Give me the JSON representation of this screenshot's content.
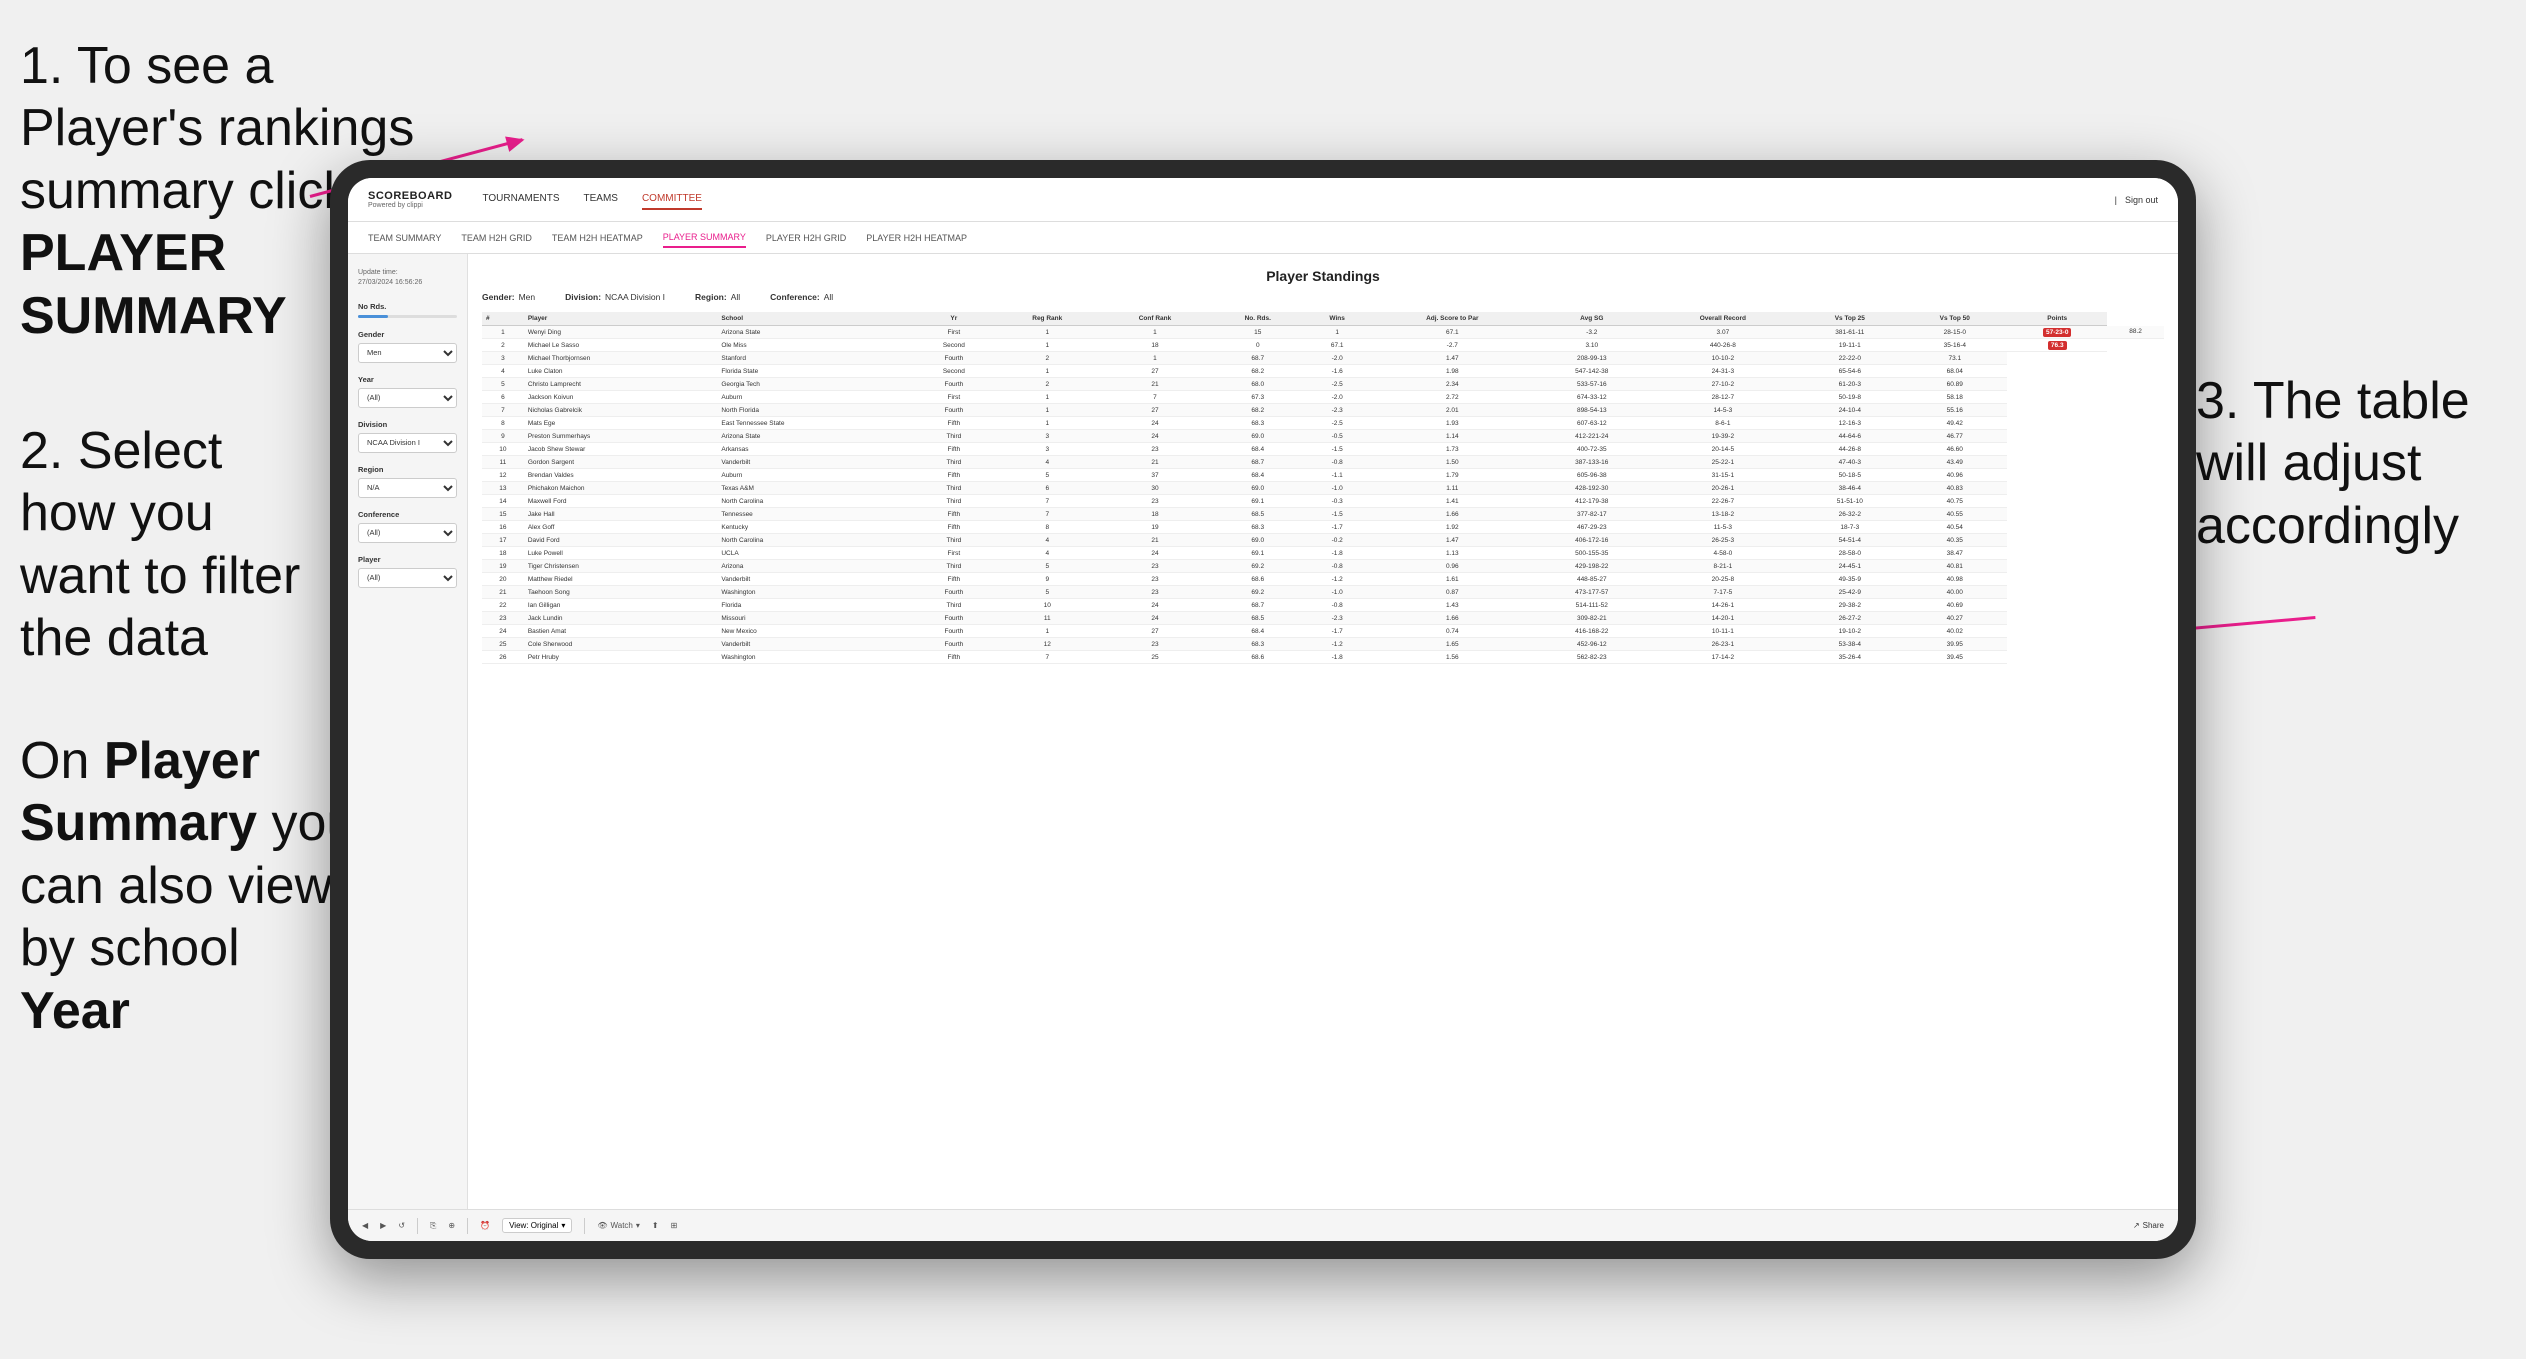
{
  "annotations": {
    "step1": {
      "number": "1.",
      "text": "To see a Player's rankings summary click ",
      "bold": "PLAYER SUMMARY"
    },
    "step2": {
      "number": "2.",
      "text": "Select how you want to filter the data"
    },
    "step3_bottom": {
      "text": "On ",
      "bold1": "Player Summary",
      "text2": " you can also view by school ",
      "bold2": "Year"
    },
    "step3_right": {
      "text": "3. The table will adjust accordingly"
    }
  },
  "app": {
    "logo": "SCOREBOARD",
    "logo_sub": "Powered by clippi",
    "sign_in": "Sign out",
    "nav": [
      "TOURNAMENTS",
      "TEAMS",
      "COMMITTEE"
    ],
    "active_nav": "COMMITTEE",
    "subnav": [
      "TEAM SUMMARY",
      "TEAM H2H GRID",
      "TEAM H2H HEATMAP",
      "PLAYER SUMMARY",
      "PLAYER H2H GRID",
      "PLAYER H2H HEATMAP"
    ],
    "active_subnav": "PLAYER SUMMARY"
  },
  "sidebar": {
    "update_label": "Update time:",
    "update_time": "27/03/2024 16:56:26",
    "no_rds_label": "No Rds.",
    "gender_label": "Gender",
    "gender_value": "Men",
    "year_label": "Year",
    "year_value": "(All)",
    "division_label": "Division",
    "division_value": "NCAA Division I",
    "region_label": "Region",
    "region_value": "N/A",
    "conference_label": "Conference",
    "conference_value": "(All)",
    "player_label": "Player",
    "player_value": "(All)"
  },
  "table": {
    "title": "Player Standings",
    "filters": {
      "gender_label": "Gender:",
      "gender_value": "Men",
      "division_label": "Division:",
      "division_value": "NCAA Division I",
      "region_label": "Region:",
      "region_value": "All",
      "conference_label": "Conference:",
      "conference_value": "All"
    },
    "columns": [
      "#",
      "Player",
      "School",
      "Yr",
      "Reg Rank",
      "Conf Rank",
      "No. Rds.",
      "Wins",
      "Adj. Score to Par",
      "Avg SG",
      "Overall Record",
      "Vs Top 25",
      "Vs Top 50",
      "Points"
    ],
    "rows": [
      [
        "1",
        "Wenyi Ding",
        "Arizona State",
        "First",
        "1",
        "1",
        "15",
        "1",
        "67.1",
        "-3.2",
        "3.07",
        "381-61-11",
        "28-15-0",
        "57-23-0",
        "88.2"
      ],
      [
        "2",
        "Michael Le Sasso",
        "Ole Miss",
        "Second",
        "1",
        "18",
        "0",
        "67.1",
        "-2.7",
        "3.10",
        "440-26-8",
        "19-11-1",
        "35-16-4",
        "76.3"
      ],
      [
        "3",
        "Michael Thorbjornsen",
        "Stanford",
        "Fourth",
        "2",
        "1",
        "68.7",
        "-2.0",
        "1.47",
        "208-99-13",
        "10-10-2",
        "22-22-0",
        "73.1"
      ],
      [
        "4",
        "Luke Claton",
        "Florida State",
        "Second",
        "1",
        "27",
        "68.2",
        "-1.6",
        "1.98",
        "547-142-38",
        "24-31-3",
        "65-54-6",
        "68.04"
      ],
      [
        "5",
        "Christo Lamprecht",
        "Georgia Tech",
        "Fourth",
        "2",
        "21",
        "68.0",
        "-2.5",
        "2.34",
        "533-57-16",
        "27-10-2",
        "61-20-3",
        "60.89"
      ],
      [
        "6",
        "Jackson Koivun",
        "Auburn",
        "First",
        "1",
        "7",
        "67.3",
        "-2.0",
        "2.72",
        "674-33-12",
        "28-12-7",
        "50-19-8",
        "58.18"
      ],
      [
        "7",
        "Nicholas Gabrelcik",
        "North Florida",
        "Fourth",
        "1",
        "27",
        "68.2",
        "-2.3",
        "2.01",
        "898-54-13",
        "14-5-3",
        "24-10-4",
        "55.16"
      ],
      [
        "8",
        "Mats Ege",
        "East Tennessee State",
        "Fifth",
        "1",
        "24",
        "68.3",
        "-2.5",
        "1.93",
        "607-63-12",
        "8-6-1",
        "12-16-3",
        "49.42"
      ],
      [
        "9",
        "Preston Summerhays",
        "Arizona State",
        "Third",
        "3",
        "24",
        "69.0",
        "-0.5",
        "1.14",
        "412-221-24",
        "19-39-2",
        "44-64-6",
        "46.77"
      ],
      [
        "10",
        "Jacob Shew Stewar",
        "Arkansas",
        "Fifth",
        "3",
        "23",
        "68.4",
        "-1.5",
        "1.73",
        "400-72-35",
        "20-14-5",
        "44-26-8",
        "46.60"
      ],
      [
        "11",
        "Gordon Sargent",
        "Vanderbilt",
        "Third",
        "4",
        "21",
        "68.7",
        "-0.8",
        "1.50",
        "387-133-16",
        "25-22-1",
        "47-40-3",
        "43.49"
      ],
      [
        "12",
        "Brendan Valdes",
        "Auburn",
        "Fifth",
        "5",
        "37",
        "68.4",
        "-1.1",
        "1.79",
        "605-96-38",
        "31-15-1",
        "50-18-5",
        "40.96"
      ],
      [
        "13",
        "Phichakon Maichon",
        "Texas A&M",
        "Third",
        "6",
        "30",
        "69.0",
        "-1.0",
        "1.11",
        "428-192-30",
        "20-26-1",
        "38-46-4",
        "40.83"
      ],
      [
        "14",
        "Maxwell Ford",
        "North Carolina",
        "Third",
        "7",
        "23",
        "69.1",
        "-0.3",
        "1.41",
        "412-179-38",
        "22-26-7",
        "51-51-10",
        "40.75"
      ],
      [
        "15",
        "Jake Hall",
        "Tennessee",
        "Fifth",
        "7",
        "18",
        "68.5",
        "-1.5",
        "1.66",
        "377-82-17",
        "13-18-2",
        "26-32-2",
        "40.55"
      ],
      [
        "16",
        "Alex Goff",
        "Kentucky",
        "Fifth",
        "8",
        "19",
        "68.3",
        "-1.7",
        "1.92",
        "467-29-23",
        "11-5-3",
        "18-7-3",
        "40.54"
      ],
      [
        "17",
        "David Ford",
        "North Carolina",
        "Third",
        "4",
        "21",
        "69.0",
        "-0.2",
        "1.47",
        "406-172-16",
        "26-25-3",
        "54-51-4",
        "40.35"
      ],
      [
        "18",
        "Luke Powell",
        "UCLA",
        "First",
        "4",
        "24",
        "69.1",
        "-1.8",
        "1.13",
        "500-155-35",
        "4-58-0",
        "28-58-0",
        "38.47"
      ],
      [
        "19",
        "Tiger Christensen",
        "Arizona",
        "Third",
        "5",
        "23",
        "69.2",
        "-0.8",
        "0.96",
        "429-198-22",
        "8-21-1",
        "24-45-1",
        "40.81"
      ],
      [
        "20",
        "Matthew Riedel",
        "Vanderbilt",
        "Fifth",
        "9",
        "23",
        "68.6",
        "-1.2",
        "1.61",
        "448-85-27",
        "20-25-8",
        "49-35-9",
        "40.98"
      ],
      [
        "21",
        "Taehoon Song",
        "Washington",
        "Fourth",
        "5",
        "23",
        "69.2",
        "-1.0",
        "0.87",
        "473-177-57",
        "7-17-5",
        "25-42-9",
        "40.00"
      ],
      [
        "22",
        "Ian Gilligan",
        "Florida",
        "Third",
        "10",
        "24",
        "68.7",
        "-0.8",
        "1.43",
        "514-111-52",
        "14-26-1",
        "29-38-2",
        "40.69"
      ],
      [
        "23",
        "Jack Lundin",
        "Missouri",
        "Fourth",
        "11",
        "24",
        "68.5",
        "-2.3",
        "1.66",
        "309-82-21",
        "14-20-1",
        "26-27-2",
        "40.27"
      ],
      [
        "24",
        "Bastien Amat",
        "New Mexico",
        "Fourth",
        "1",
        "27",
        "68.4",
        "-1.7",
        "0.74",
        "416-168-22",
        "10-11-1",
        "19-10-2",
        "40.02"
      ],
      [
        "25",
        "Cole Sherwood",
        "Vanderbilt",
        "Fourth",
        "12",
        "23",
        "68.3",
        "-1.2",
        "1.65",
        "452-96-12",
        "26-23-1",
        "53-38-4",
        "39.95"
      ],
      [
        "26",
        "Petr Hruby",
        "Washington",
        "Fifth",
        "7",
        "25",
        "68.6",
        "-1.8",
        "1.56",
        "562-82-23",
        "17-14-2",
        "35-26-4",
        "39.45"
      ]
    ]
  },
  "toolbar": {
    "back": "◀",
    "forward": "▶",
    "refresh": "↺",
    "view_label": "View: Original",
    "watch_label": "Watch",
    "share_label": "Share"
  }
}
